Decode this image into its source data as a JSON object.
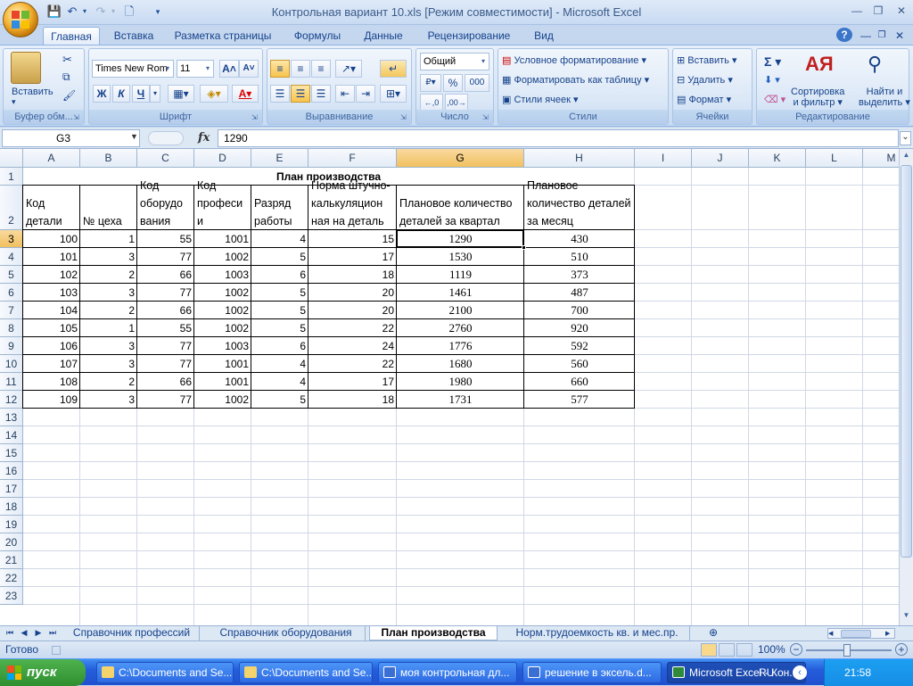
{
  "window": {
    "title": "Контрольная вариант 10.xls  [Режим совместимости] - Microsoft Excel"
  },
  "tabs": [
    "Главная",
    "Вставка",
    "Разметка страницы",
    "Формулы",
    "Данные",
    "Рецензирование",
    "Вид"
  ],
  "ribbon": {
    "clipboard": {
      "label": "Буфер обм...",
      "paste": "Вставить"
    },
    "font": {
      "label": "Шрифт",
      "name": "Times New Rom",
      "size": "11",
      "bold": "Ж",
      "italic": "К",
      "underline": "Ч"
    },
    "align": {
      "label": "Выравнивание"
    },
    "number": {
      "label": "Число",
      "format": "Общий"
    },
    "styles": {
      "label": "Стили",
      "cond": "Условное форматирование",
      "table": "Форматировать как таблицу",
      "cell": "Стили ячеек"
    },
    "cells": {
      "label": "Ячейки",
      "insert": "Вставить",
      "delete": "Удалить",
      "format": "Формат"
    },
    "edit": {
      "label": "Редактирование",
      "sort1": "Сортировка",
      "sort2": "и фильтр",
      "find1": "Найти и",
      "find2": "выделить"
    }
  },
  "formula_bar": {
    "name_box": "G3",
    "fx": "fx",
    "value": "1290"
  },
  "columns": [
    "A",
    "B",
    "C",
    "D",
    "E",
    "F",
    "G",
    "H",
    "I",
    "J",
    "K",
    "L",
    "M"
  ],
  "rows": [
    "1",
    "2",
    "3",
    "4",
    "5",
    "6",
    "7",
    "8",
    "9",
    "10",
    "11",
    "12",
    "13",
    "14",
    "15",
    "16",
    "17",
    "18",
    "19",
    "20",
    "21",
    "22",
    "23"
  ],
  "sheet": {
    "title": "План производства",
    "headers": [
      "Код детали",
      "№ цеха",
      "Код оборудо вания",
      "Код професи и",
      "Разряд работы",
      "Норма штучно-калькуляцион ная на деталь",
      "Плановое количество деталей за квартал",
      "Плановое количество деталей за месяц"
    ],
    "data": [
      [
        "100",
        "1",
        "55",
        "1001",
        "4",
        "15",
        "1290",
        "430"
      ],
      [
        "101",
        "3",
        "77",
        "1002",
        "5",
        "17",
        "1530",
        "510"
      ],
      [
        "102",
        "2",
        "66",
        "1003",
        "6",
        "18",
        "1119",
        "373"
      ],
      [
        "103",
        "3",
        "77",
        "1002",
        "5",
        "20",
        "1461",
        "487"
      ],
      [
        "104",
        "2",
        "66",
        "1002",
        "5",
        "20",
        "2100",
        "700"
      ],
      [
        "105",
        "1",
        "55",
        "1002",
        "5",
        "22",
        "2760",
        "920"
      ],
      [
        "106",
        "3",
        "77",
        "1003",
        "6",
        "24",
        "1776",
        "592"
      ],
      [
        "107",
        "3",
        "77",
        "1001",
        "4",
        "22",
        "1680",
        "560"
      ],
      [
        "108",
        "2",
        "66",
        "1001",
        "4",
        "17",
        "1980",
        "660"
      ],
      [
        "109",
        "3",
        "77",
        "1002",
        "5",
        "18",
        "1731",
        "577"
      ]
    ]
  },
  "sheet_tabs": [
    "Справочник профессий",
    "Справочник оборудования",
    "План производства",
    "Норм.трудоемкость кв. и мес.пр."
  ],
  "status": {
    "ready": "Готово",
    "zoom": "100%"
  },
  "taskbar": {
    "start": "пуск",
    "items": [
      "C:\\Documents and Se...",
      "C:\\Documents and Se...",
      "моя контрольная дл...",
      "решение в эксель.d...",
      "Microsoft Excel - Кон..."
    ],
    "lang": "RU",
    "time": "21:58"
  },
  "colors": {
    "selection": "#f1c15f",
    "ribbon": "#d4e3f5",
    "taskbar": "#245ddb"
  }
}
